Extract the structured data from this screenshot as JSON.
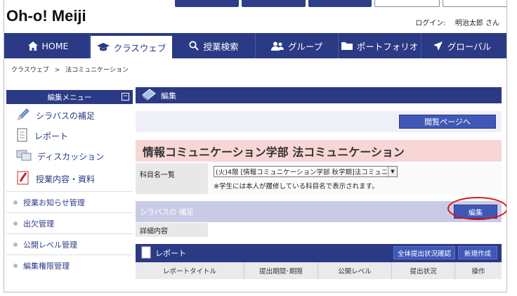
{
  "header": {
    "logo": "Oh-o! Meiji",
    "login_label": "ログイン:",
    "user_name": "明治太郎 さん"
  },
  "nav": {
    "items": [
      {
        "label": "HOME",
        "icon": "home-icon"
      },
      {
        "label": "クラスウェブ",
        "icon": "mortarboard-icon"
      },
      {
        "label": "授業検索",
        "icon": "search-icon"
      },
      {
        "label": "グループ",
        "icon": "group-icon"
      },
      {
        "label": "ポートフォリオ",
        "icon": "folder-icon"
      },
      {
        "label": "グローバル",
        "icon": "airplane-icon"
      }
    ]
  },
  "breadcrumb": {
    "parent": "クラスウェブ",
    "separator": ">",
    "current": "法コミュニケーション"
  },
  "sidebar": {
    "header": "編集メニュー",
    "collapse": "−",
    "main_items": [
      {
        "label": "シラバスの補足",
        "icon": "pencil-icon"
      },
      {
        "label": "レポート",
        "icon": "document-icon"
      },
      {
        "label": "ディスカッション",
        "icon": "computer-icon"
      },
      {
        "label": "授業内容・資料",
        "icon": "notebook-icon"
      }
    ],
    "sub_items": [
      {
        "label": "授業お知らせ管理"
      },
      {
        "label": "出欠管理"
      },
      {
        "label": "公開レベル管理"
      },
      {
        "label": "編集権限管理"
      }
    ]
  },
  "main": {
    "section_title": "編集",
    "view_page_button": "閲覧ページへ",
    "course_title": "情報コミュニケーション学部 法コミュニケーション",
    "subject_list_label": "科目名一覧",
    "subject_selected": "(火)4限 [情報コミュニケーション学部 秋学期]法コミュニケーシ",
    "subject_note": "※学生には本人が履修している科目名で表示されます。",
    "syllabus_label": "シラバスの 補足",
    "edit_button": "編集",
    "detail_label": "詳細内容",
    "report_title": "レポート",
    "report_status_button": "全体提出状況確認",
    "report_new_button": "新規作成",
    "report_columns": [
      "レポートタイトル",
      "提出期間･期限",
      "公開レベル",
      "提出状況",
      "操作"
    ]
  },
  "colors": {
    "nav_bg": "#2b3a85",
    "button": "#3f58b8",
    "title_bg": "#f9d6d6",
    "highlight_ring": "#e01010"
  }
}
